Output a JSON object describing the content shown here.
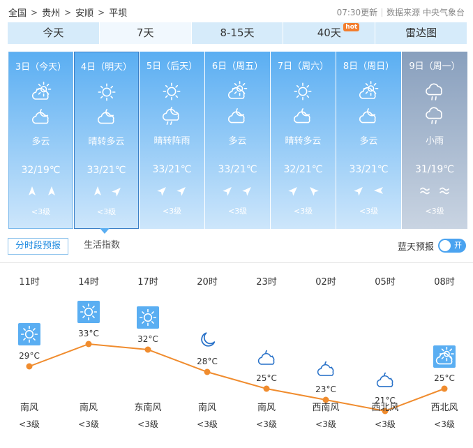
{
  "breadcrumb": [
    "全国",
    "贵州",
    "安顺",
    "平坝"
  ],
  "meta": {
    "updated": "07:30更新",
    "source": "数据来源 中央气象台"
  },
  "tabs": [
    {
      "label": "今天",
      "active": false
    },
    {
      "label": "7天",
      "active": true
    },
    {
      "label": "8-15天",
      "active": false
    },
    {
      "label": "40天",
      "active": false,
      "badge": "hot"
    },
    {
      "label": "雷达图",
      "active": false
    }
  ],
  "days": [
    {
      "date": "3日（今天）",
      "icon_day": "partly-cloudy-icon",
      "icon_night": "cloudy-night-icon",
      "desc": "多云",
      "temp": "32/19℃",
      "wind_icons": [
        "north-arrow-icon",
        "north-arrow-icon"
      ],
      "level": "<3级"
    },
    {
      "date": "4日（明天）",
      "icon_day": "sunny-icon",
      "icon_night": "cloudy-night-icon",
      "desc": "晴转多云",
      "temp": "33/21℃",
      "wind_icons": [
        "north-arrow-icon",
        "northeast-arrow-icon"
      ],
      "level": "<3级"
    },
    {
      "date": "5日（后天）",
      "icon_day": "sunny-icon",
      "icon_night": "shower-night-icon",
      "desc": "晴转阵雨",
      "temp": "33/21℃",
      "wind_icons": [
        "northeast-arrow-icon",
        "northeast-arrow-icon"
      ],
      "level": "<3级"
    },
    {
      "date": "6日（周五）",
      "icon_day": "partly-cloudy-icon",
      "icon_night": "cloudy-night-icon",
      "desc": "多云",
      "temp": "33/21℃",
      "wind_icons": [
        "northeast-arrow-icon",
        "northeast-arrow-icon"
      ],
      "level": "<3级"
    },
    {
      "date": "7日（周六）",
      "icon_day": "sunny-icon",
      "icon_night": "cloudy-night-icon",
      "desc": "晴转多云",
      "temp": "32/21℃",
      "wind_icons": [
        "northeast-arrow-icon",
        "northwest-arrow-icon"
      ],
      "level": "<3级"
    },
    {
      "date": "8日（周日）",
      "icon_day": "partly-cloudy-icon",
      "icon_night": "cloudy-night-icon",
      "desc": "多云",
      "temp": "33/21℃",
      "wind_icons": [
        "northeast-arrow-icon",
        "west-arrow-icon"
      ],
      "level": "<3级"
    },
    {
      "date": "9日（周一）",
      "icon_day": "light-rain-icon",
      "icon_night": "light-rain-icon",
      "desc": "小雨",
      "temp": "31/19℃",
      "wind_icons": [
        "swirl-wind-icon",
        "swirl-wind-icon"
      ],
      "level": "<3级"
    }
  ],
  "subtabs": {
    "hourly": "分时段预报",
    "life": "生活指数"
  },
  "bluesky": {
    "label": "蓝天预报",
    "toggle": "开"
  },
  "hourly": [
    {
      "time": "11时",
      "icon": "sunny-icon",
      "temp": "29°C",
      "temp_value": 29,
      "wind": "南风",
      "level": "<3级"
    },
    {
      "time": "14时",
      "icon": "sunny-icon",
      "temp": "33°C",
      "temp_value": 33,
      "wind": "南风",
      "level": "<3级"
    },
    {
      "time": "17时",
      "icon": "sunny-icon",
      "temp": "32°C",
      "temp_value": 32,
      "wind": "东南风",
      "level": "<3级"
    },
    {
      "time": "20时",
      "icon": "moon-icon",
      "temp": "28°C",
      "temp_value": 28,
      "wind": "南风",
      "level": "<3级"
    },
    {
      "time": "23时",
      "icon": "cloudy-night-icon",
      "temp": "25°C",
      "temp_value": 25,
      "wind": "南风",
      "level": "<3级"
    },
    {
      "time": "02时",
      "icon": "cloudy-night-icon",
      "temp": "23°C",
      "temp_value": 23,
      "wind": "西南风",
      "level": "<3级"
    },
    {
      "time": "05时",
      "icon": "cloudy-night-icon",
      "temp": "21°C",
      "temp_value": 21,
      "wind": "西北风",
      "level": "<3级"
    },
    {
      "time": "08时",
      "icon": "partly-cloudy-icon",
      "temp": "25°C",
      "temp_value": 25,
      "wind": "西北风",
      "level": "<3级"
    }
  ],
  "colors": {
    "accent": "#4aa3f0",
    "curve": "#f08c2e",
    "tab_bg": "#d6ebfa",
    "card_top": "#5aaef2",
    "rain_top": "#889fbd",
    "hot_badge": "#f37e2e"
  }
}
